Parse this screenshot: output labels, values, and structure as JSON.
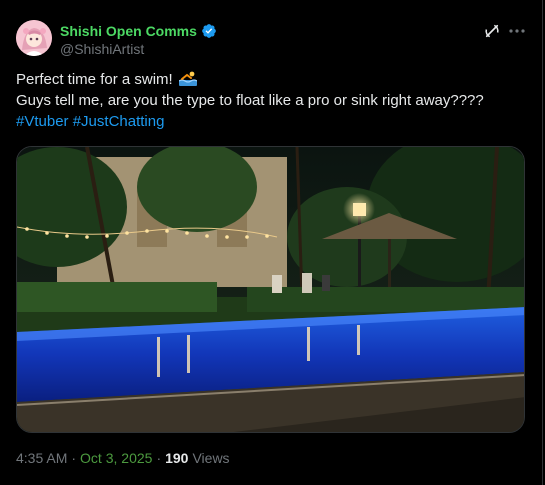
{
  "author": {
    "display_name": "Shishi Open Comms",
    "handle": "@ShishiArtist",
    "verified": true,
    "name_color": "#4cd964"
  },
  "tweet": {
    "line1": "Perfect time for a swim!",
    "line1_emoji": "person-swimming-emoji",
    "line2": "Guys tell me, are you the type to float like a pro or sink right away????",
    "hashtags": [
      "#Vtuber",
      "#JustChatting"
    ]
  },
  "media": {
    "description_icon": "night-pool-photo"
  },
  "meta": {
    "time": "4:35 AM",
    "separator": "·",
    "date": "Oct 3, 2025",
    "views_count": "190",
    "views_label": "Views"
  },
  "icons": {
    "grok": "grok-icon",
    "more": "more-options-icon"
  },
  "colors": {
    "background": "#000000",
    "text": "#e7e9ea",
    "muted": "#71767b",
    "link": "#1d9bf0",
    "verified": "#1d9bf0"
  }
}
